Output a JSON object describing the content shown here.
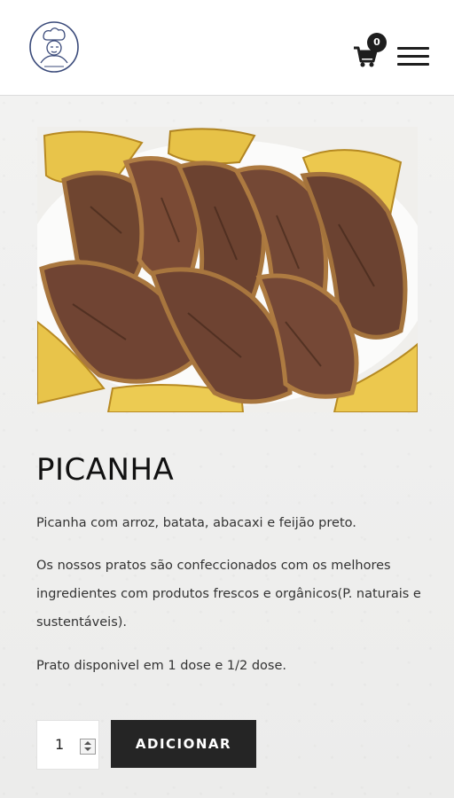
{
  "header": {
    "logo_icon": "chef-portrait-logo-icon",
    "cart_icon": "cart-icon",
    "cart_count": "0",
    "menu_icon": "hamburger-menu-icon"
  },
  "product": {
    "image_icon": "picanha-dish-photo",
    "title": "PICANHA",
    "short_description": "Picanha com arroz, batata, abacaxi e feijão preto.",
    "description": "Os nossos pratos são confeccionados com os melhores ingredientes com produtos frescos e orgânicos(P. naturais e sustentáveis).",
    "availability": "Prato disponivel em 1 dose e 1/2 dose."
  },
  "cart_form": {
    "quantity": "1",
    "add_label": "ADICIONAR"
  },
  "colors": {
    "button_bg": "#252525",
    "page_bg": "#efefee",
    "header_bg": "#ffffff"
  }
}
